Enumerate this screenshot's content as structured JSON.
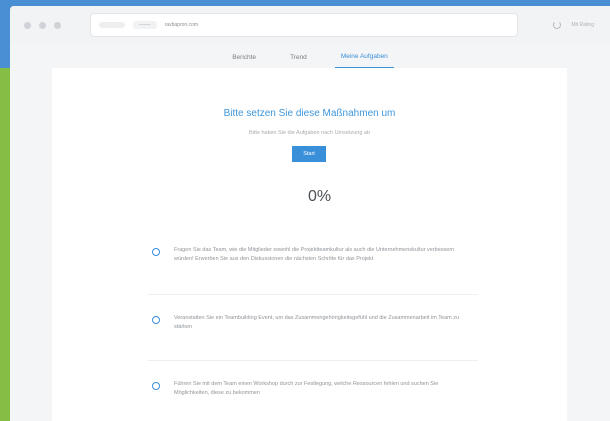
{
  "browser": {
    "url_chip": "-------",
    "url": "ravbapron.com",
    "right_label": "Mit Rating"
  },
  "tabs": [
    {
      "label": "Berichte",
      "active": false
    },
    {
      "label": "Trend",
      "active": false
    },
    {
      "label": "Meine Aufgaben",
      "active": true
    }
  ],
  "main": {
    "heading": "Bitte setzen Sie diese Maßnahmen um",
    "subheading": "Bitte haken Sie die Aufgaben nach Umsetzung ab",
    "start_label": "Start",
    "progress": "0%"
  },
  "tasks": [
    {
      "text": "Fragen Sie das Team, wie die Mitglieder sowohl die Projektteamkultur als auch die Unternehmenskultur verbessern würden! Erwerben Sie aus den Diskussionen die nächsten Schritte für das Projekt",
      "done": false
    },
    {
      "text": "Veranstalten Sie ein Teambuilding Event, um das Zusammengehörigkeitsgefühl und die Zusammenarbeit im Team zu stärken",
      "done": false
    },
    {
      "text": "Führen Sie mit dem Team einen Workshop durch zur Festlegung, welche Ressourcen fehlen und suchen Sie Möglichkeiten, diese zu bekommen",
      "done": false
    }
  ],
  "colors": {
    "accent": "#3a8fd9",
    "page_bg": "#4a8fd4",
    "side_strip": "#86bd44"
  }
}
